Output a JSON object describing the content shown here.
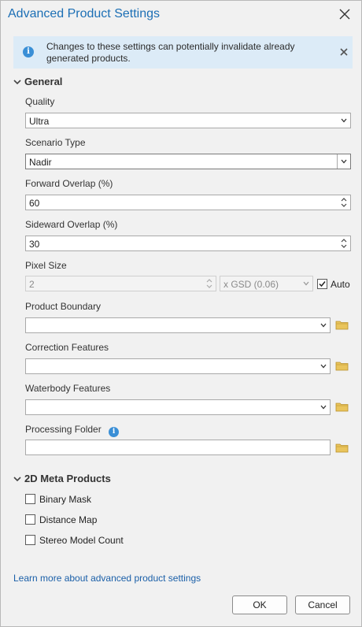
{
  "dialog": {
    "title": "Advanced Product Settings",
    "close_icon": "close-icon"
  },
  "banner": {
    "icon": "info-icon",
    "message": "Changes to these settings can potentially invalidate already generated products."
  },
  "general": {
    "header": "General",
    "quality": {
      "label": "Quality",
      "value": "Ultra"
    },
    "scenario_type": {
      "label": "Scenario Type",
      "value": "Nadir"
    },
    "forward_overlap": {
      "label": "Forward Overlap (%)",
      "value": "60"
    },
    "sideward_overlap": {
      "label": "Sideward Overlap (%)",
      "value": "30"
    },
    "pixel_size": {
      "label": "Pixel Size",
      "value": "2",
      "unit": "x GSD (0.06)",
      "auto_label": "Auto",
      "auto_checked": true
    },
    "product_boundary": {
      "label": "Product Boundary",
      "value": ""
    },
    "correction_features": {
      "label": "Correction Features",
      "value": ""
    },
    "waterbody_features": {
      "label": "Waterbody Features",
      "value": ""
    },
    "processing_folder": {
      "label": "Processing Folder",
      "value": ""
    }
  },
  "meta_products": {
    "header": "2D Meta Products",
    "items": [
      {
        "label": "Binary Mask",
        "checked": false
      },
      {
        "label": "Distance Map",
        "checked": false
      },
      {
        "label": "Stereo Model Count",
        "checked": false
      }
    ]
  },
  "footer": {
    "learn_more": "Learn more about advanced product settings",
    "ok": "OK",
    "cancel": "Cancel"
  },
  "colors": {
    "title": "#1c6fb5",
    "banner_bg": "#dcebf7",
    "folder": "#e0b84a",
    "link": "#1a5fa8"
  }
}
